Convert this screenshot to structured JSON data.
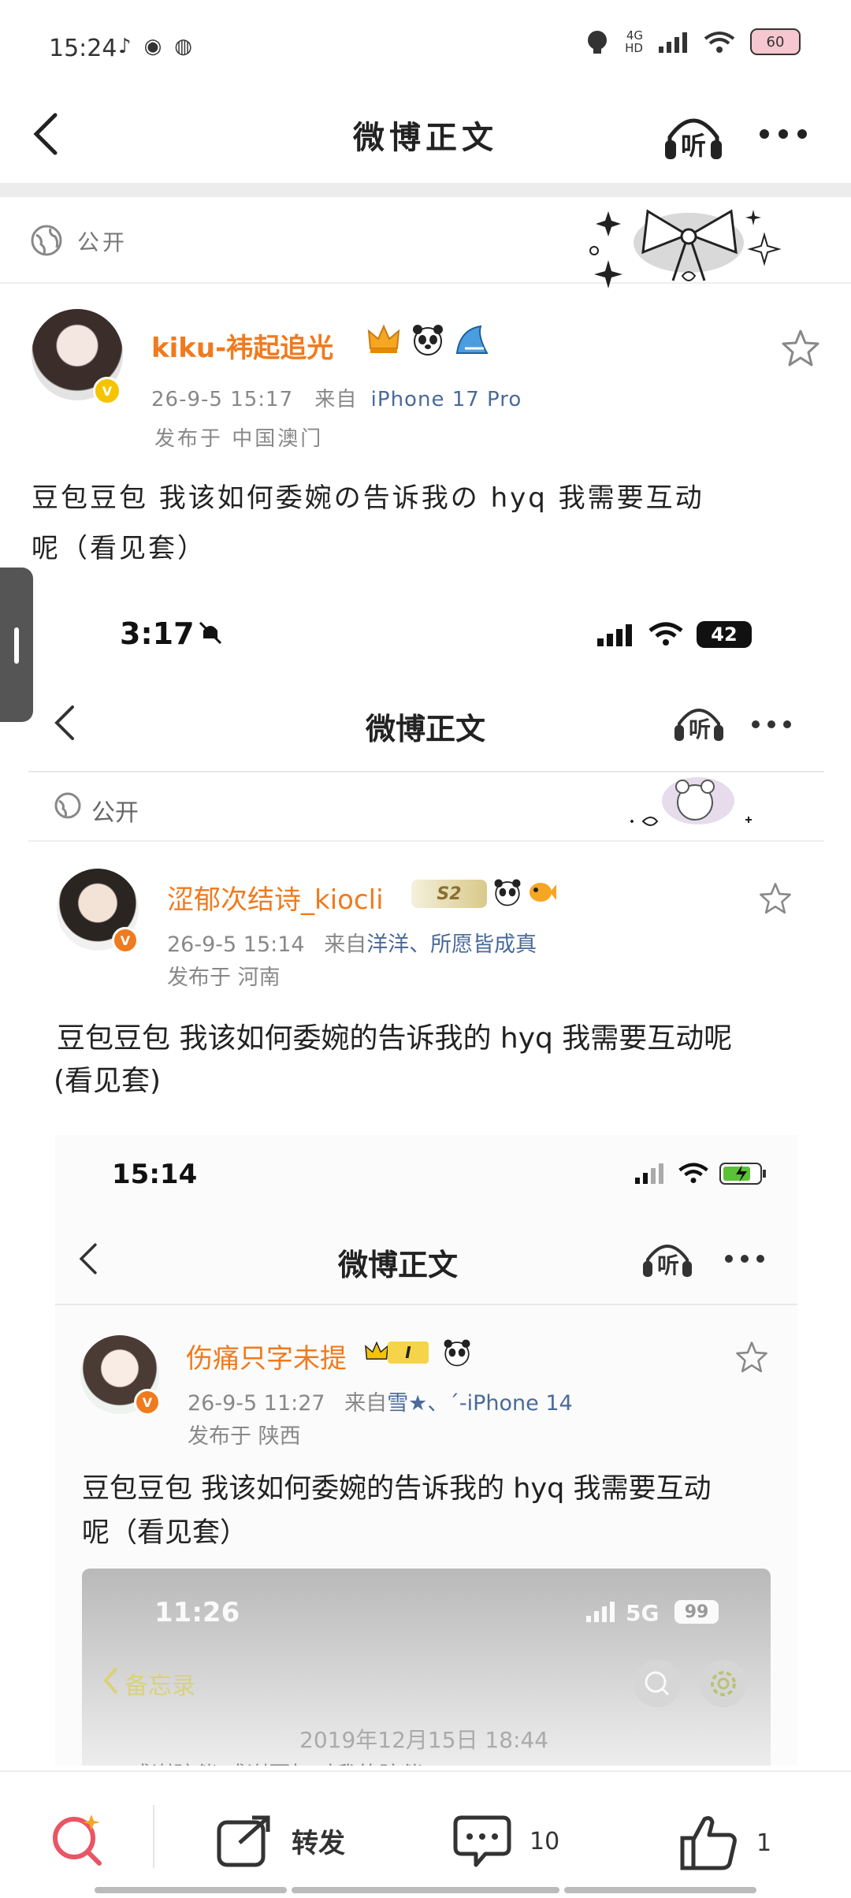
{
  "status_bar": {
    "time": "15:24",
    "network": "4G",
    "network_sub": "HD",
    "battery": "60"
  },
  "header": {
    "title": "微博正文",
    "listen_label": "听"
  },
  "visibility": "公开",
  "post": {
    "username": "kiku-袆起追光",
    "date": "26-9-5 15:17",
    "source_prefix": "来自",
    "source": "iPhone 17 Pro",
    "location": "发布于 中国澳门",
    "text_line1": "豆包豆包 我该如何委婉の告诉我の hyq 我需要互动",
    "text_line2": "呢（看见套）"
  },
  "shot1": {
    "status_time": "3:17",
    "battery": "42",
    "title": "微博正文",
    "listen_label": "听",
    "visibility": "公开",
    "username": "涩郁次结诗_kiocli",
    "badge": "S2",
    "date": "26-9-5 15:14",
    "source_prefix": "来自",
    "source": "洋洋",
    "source_suffix": "、所愿皆成真",
    "location": "发布于 河南",
    "text_line1": "豆包豆包 我该如何委婉的告诉我的 hyq 我需要互动呢",
    "text_line2": "(看见套)"
  },
  "shot2": {
    "status_time": "15:14",
    "title": "微博正文",
    "listen_label": "听",
    "username": "伤痛只字未提",
    "badge": "I",
    "date": "26-9-5 11:27",
    "source_prefix": "来自",
    "source": "雪★、ˊ-iPhone 14",
    "location": "发布于 陕西",
    "text_line1": "豆包豆包 我该如何委婉的告诉我的 hyq 我需要互动",
    "text_line2": "呢（看见套）"
  },
  "shot3": {
    "status_time": "11:26",
    "network": "5G",
    "battery": "99",
    "back_label": "备忘录",
    "date_line": "2019年12月15日 18:44",
    "partial_text": "感谢陪伴 感谢回忆时我的陪伴"
  },
  "bottom_bar": {
    "repost": "转发",
    "comments": "10",
    "likes": "1"
  }
}
